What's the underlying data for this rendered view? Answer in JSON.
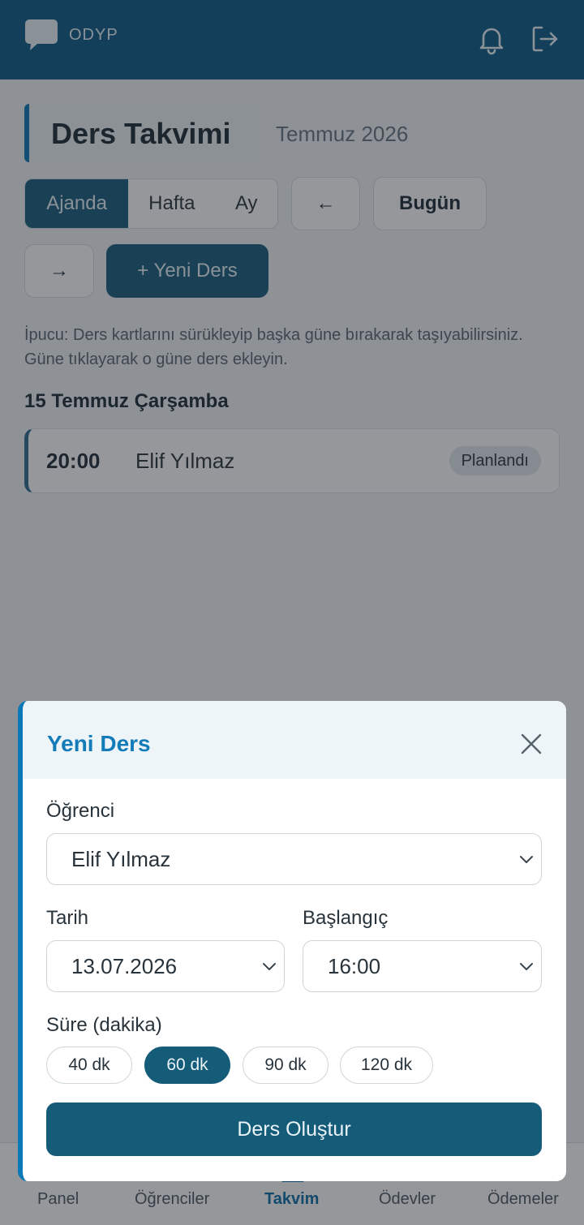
{
  "header": {
    "brand": "ODYP",
    "icons": [
      "chat-logo-icon",
      "bell-icon",
      "logout-icon"
    ]
  },
  "page": {
    "title": "Ders Takvimi",
    "month": "Temmuz 2026",
    "views": [
      "Ajanda",
      "Hafta",
      "Ay"
    ],
    "active_view": "Ajanda",
    "prev_label": "←",
    "today_label": "Bugün",
    "next_label": "→",
    "new_lesson_label": "+ Yeni Ders",
    "hint": "İpucu: Ders kartlarını sürükleyip başka güne bırakarak taşıyabilirsiniz. Güne tıklayarak o güne ders ekleyin.",
    "day_heading": "15 Temmuz Çarşamba",
    "lessons": [
      {
        "time": "20:00",
        "student": "Elif Yılmaz",
        "status": "Planlandı"
      }
    ]
  },
  "bottom_nav": {
    "items": [
      "Panel",
      "Öğrenciler",
      "Takvim",
      "Ödevler",
      "Ödemeler"
    ],
    "active": "Takvim"
  },
  "modal": {
    "title": "Yeni Ders",
    "student_label": "Öğrenci",
    "student_value": "Elif Yılmaz",
    "date_label": "Tarih",
    "date_value": "13.07.2026",
    "start_label": "Başlangıç",
    "start_value": "16:00",
    "duration_label": "Süre (dakika)",
    "durations": [
      "40 dk",
      "60 dk",
      "90 dk",
      "120 dk"
    ],
    "selected_duration": "60 dk",
    "submit_label": "Ders Oluştur"
  },
  "colors": {
    "header": "#0a5a86",
    "primary": "#155c79",
    "accent": "#0b78b8",
    "active_tab": "#0b6ea6"
  }
}
